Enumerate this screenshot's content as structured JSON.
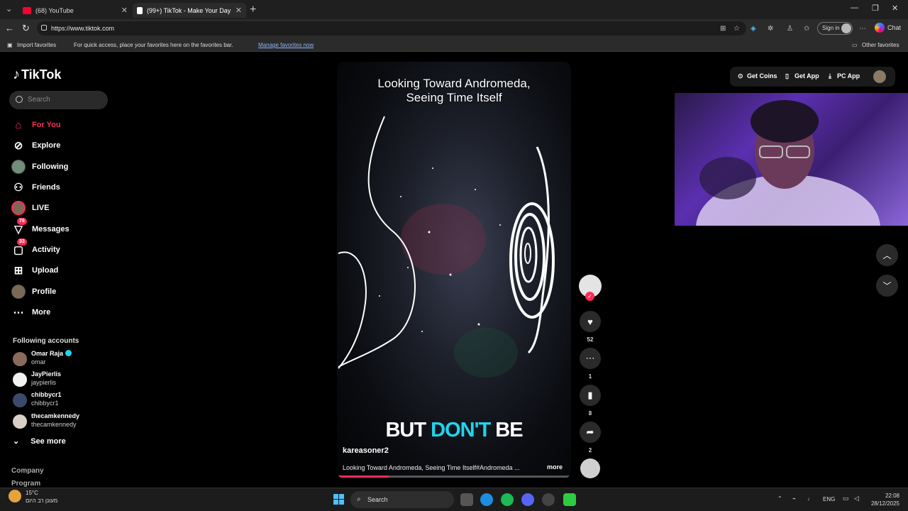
{
  "browser": {
    "tabs": [
      {
        "label": "(68) YouTube",
        "favicon_color": "#ff0033"
      },
      {
        "label": "(99+) TikTok - Make Your Day",
        "favicon_color": "#ffffff"
      }
    ],
    "url": "https://www.tiktok.com",
    "sign_in_label": "Sign in",
    "chat_label": "Chat",
    "favbar": {
      "import_label": "Import favorites",
      "prompt": "For quick access, place your favorites here on the favorites bar.",
      "manage_link": "Manage favorites now",
      "other_label": "Other favorites"
    }
  },
  "tiktok": {
    "logo_text": "TikTok",
    "search_placeholder": "Search",
    "nav": [
      {
        "label": "For You",
        "icon": "home-icon"
      },
      {
        "label": "Explore",
        "icon": "compass-icon"
      },
      {
        "label": "Following",
        "icon": "following-avatar"
      },
      {
        "label": "Friends",
        "icon": "friends-icon"
      },
      {
        "label": "LIVE",
        "icon": "live-avatar"
      },
      {
        "label": "Messages",
        "icon": "messages-icon",
        "badge": "76"
      },
      {
        "label": "Activity",
        "icon": "activity-icon",
        "badge": "33"
      },
      {
        "label": "Upload",
        "icon": "upload-icon"
      },
      {
        "label": "Profile",
        "icon": "profile-avatar"
      },
      {
        "label": "More",
        "icon": "more-icon"
      }
    ],
    "following_title": "Following accounts",
    "accounts": [
      {
        "name": "Omar Raja",
        "user": "omar",
        "verified": true
      },
      {
        "name": "JayPierlis",
        "user": "jaypierlis"
      },
      {
        "name": "chibbycr1",
        "user": "chibbycr1"
      },
      {
        "name": "thecamkennedy",
        "user": "thecamkennedy"
      }
    ],
    "see_more": "See more",
    "footer": [
      "Company",
      "Program"
    ],
    "top_actions": {
      "coins": "Get Coins",
      "app": "Get App",
      "pc": "PC App"
    }
  },
  "video": {
    "title_line1": "Looking Toward Andromeda,",
    "title_line2": "Seeing Time Itself",
    "caption_a": "BUT ",
    "caption_b": "DON'T",
    "caption_c": " BE",
    "username": "kareasoner2",
    "description": "Looking Toward Andromeda, Seeing Time Itself#Andromeda ...",
    "more_label": "more",
    "progress": 0.22,
    "likes": "52",
    "comments": "1",
    "saves": "8",
    "shares": "2"
  },
  "taskbar": {
    "temp": "15°C",
    "weather_text": "מעונן רב היום",
    "search_label": "Search",
    "lang": "ENG",
    "time": "22:08",
    "date": "28/12/2025"
  }
}
